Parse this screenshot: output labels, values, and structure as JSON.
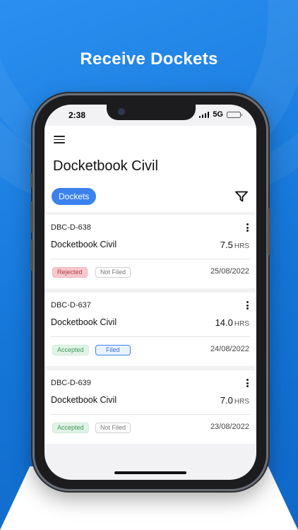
{
  "headline": "Receive Dockets",
  "status_bar": {
    "time": "2:38",
    "network": "5G"
  },
  "header": {
    "title": "Docketbook Civil",
    "filter_chip": "Dockets"
  },
  "dockets": [
    {
      "id": "DBC-D-638",
      "company": "Docketbook Civil",
      "hours": "7.5",
      "unit": "HRS",
      "status": "Rejected",
      "filing": "Not Filed",
      "date": "25/08/2022"
    },
    {
      "id": "DBC-D-637",
      "company": "Docketbook Civil",
      "hours": "14.0",
      "unit": "HRS",
      "status": "Accepted",
      "filing": "Filed",
      "date": "24/08/2022"
    },
    {
      "id": "DBC-D-639",
      "company": "Docketbook Civil",
      "hours": "7.0",
      "unit": "HRS",
      "status": "Accepted",
      "filing": "Not Filed",
      "date": "23/08/2022"
    }
  ],
  "colors": {
    "background": "#1a7fe0",
    "accent": "#3b82ef",
    "rejected": "#b03a43",
    "accepted": "#3e9a55"
  },
  "icons": [
    "menu-icon",
    "filter-icon",
    "more-vertical-icon",
    "signal-icon",
    "battery-icon"
  ]
}
